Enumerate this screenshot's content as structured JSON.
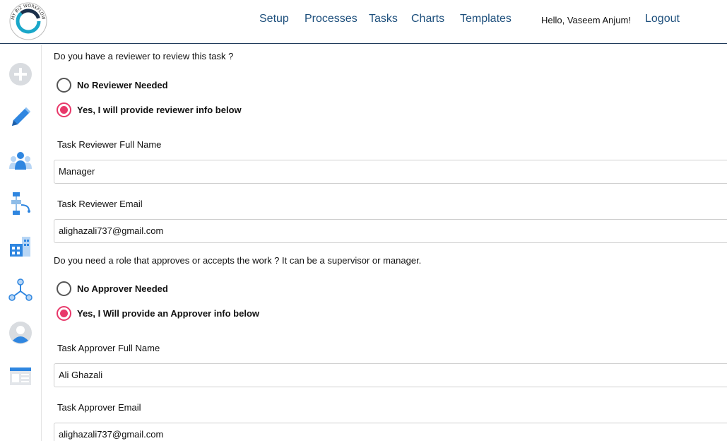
{
  "header": {
    "nav": [
      {
        "label": "Setup"
      },
      {
        "label": "Processes"
      },
      {
        "label": "Tasks"
      },
      {
        "label": "Charts"
      },
      {
        "label": "Templates"
      }
    ],
    "greeting": "Hello,  Vaseem Anjum!",
    "logout_label": "Logout",
    "logo_text": "MY BIZ WORKFLOW"
  },
  "sidebar": {
    "items": [
      {
        "icon": "add-circle-icon"
      },
      {
        "icon": "pencil-icon"
      },
      {
        "icon": "team-icon"
      },
      {
        "icon": "flowchart-icon"
      },
      {
        "icon": "building-icon"
      },
      {
        "icon": "network-icon"
      },
      {
        "icon": "user-profile-icon"
      },
      {
        "icon": "template-window-icon"
      }
    ]
  },
  "form": {
    "reviewer_question": "Do you have a reviewer to review this task ?",
    "reviewer_options": [
      {
        "label": "No Reviewer Needed",
        "selected": false
      },
      {
        "label": "Yes, I will provide reviewer info below",
        "selected": true
      }
    ],
    "reviewer_name_label": "Task Reviewer Full Name",
    "reviewer_name_value": "Manager",
    "reviewer_email_label": "Task Reviewer Email",
    "reviewer_email_value": "alighazali737@gmail.com",
    "approver_question": "Do you need a role that approves or accepts the work ? It can be a supervisor or manager.",
    "approver_options": [
      {
        "label": "No Approver Needed",
        "selected": false
      },
      {
        "label": "Yes, I Will provide an Approver info below",
        "selected": true
      }
    ],
    "approver_name_label": "Task Approver Full Name",
    "approver_name_value": "Ali Ghazali",
    "approver_email_label": "Task Approver Email",
    "approver_email_value": "alighazali737@gmail.com"
  },
  "colors": {
    "nav_link": "#1d4f7c",
    "radio_selected": "#e8386a",
    "icon_blue": "#2f86e0"
  }
}
